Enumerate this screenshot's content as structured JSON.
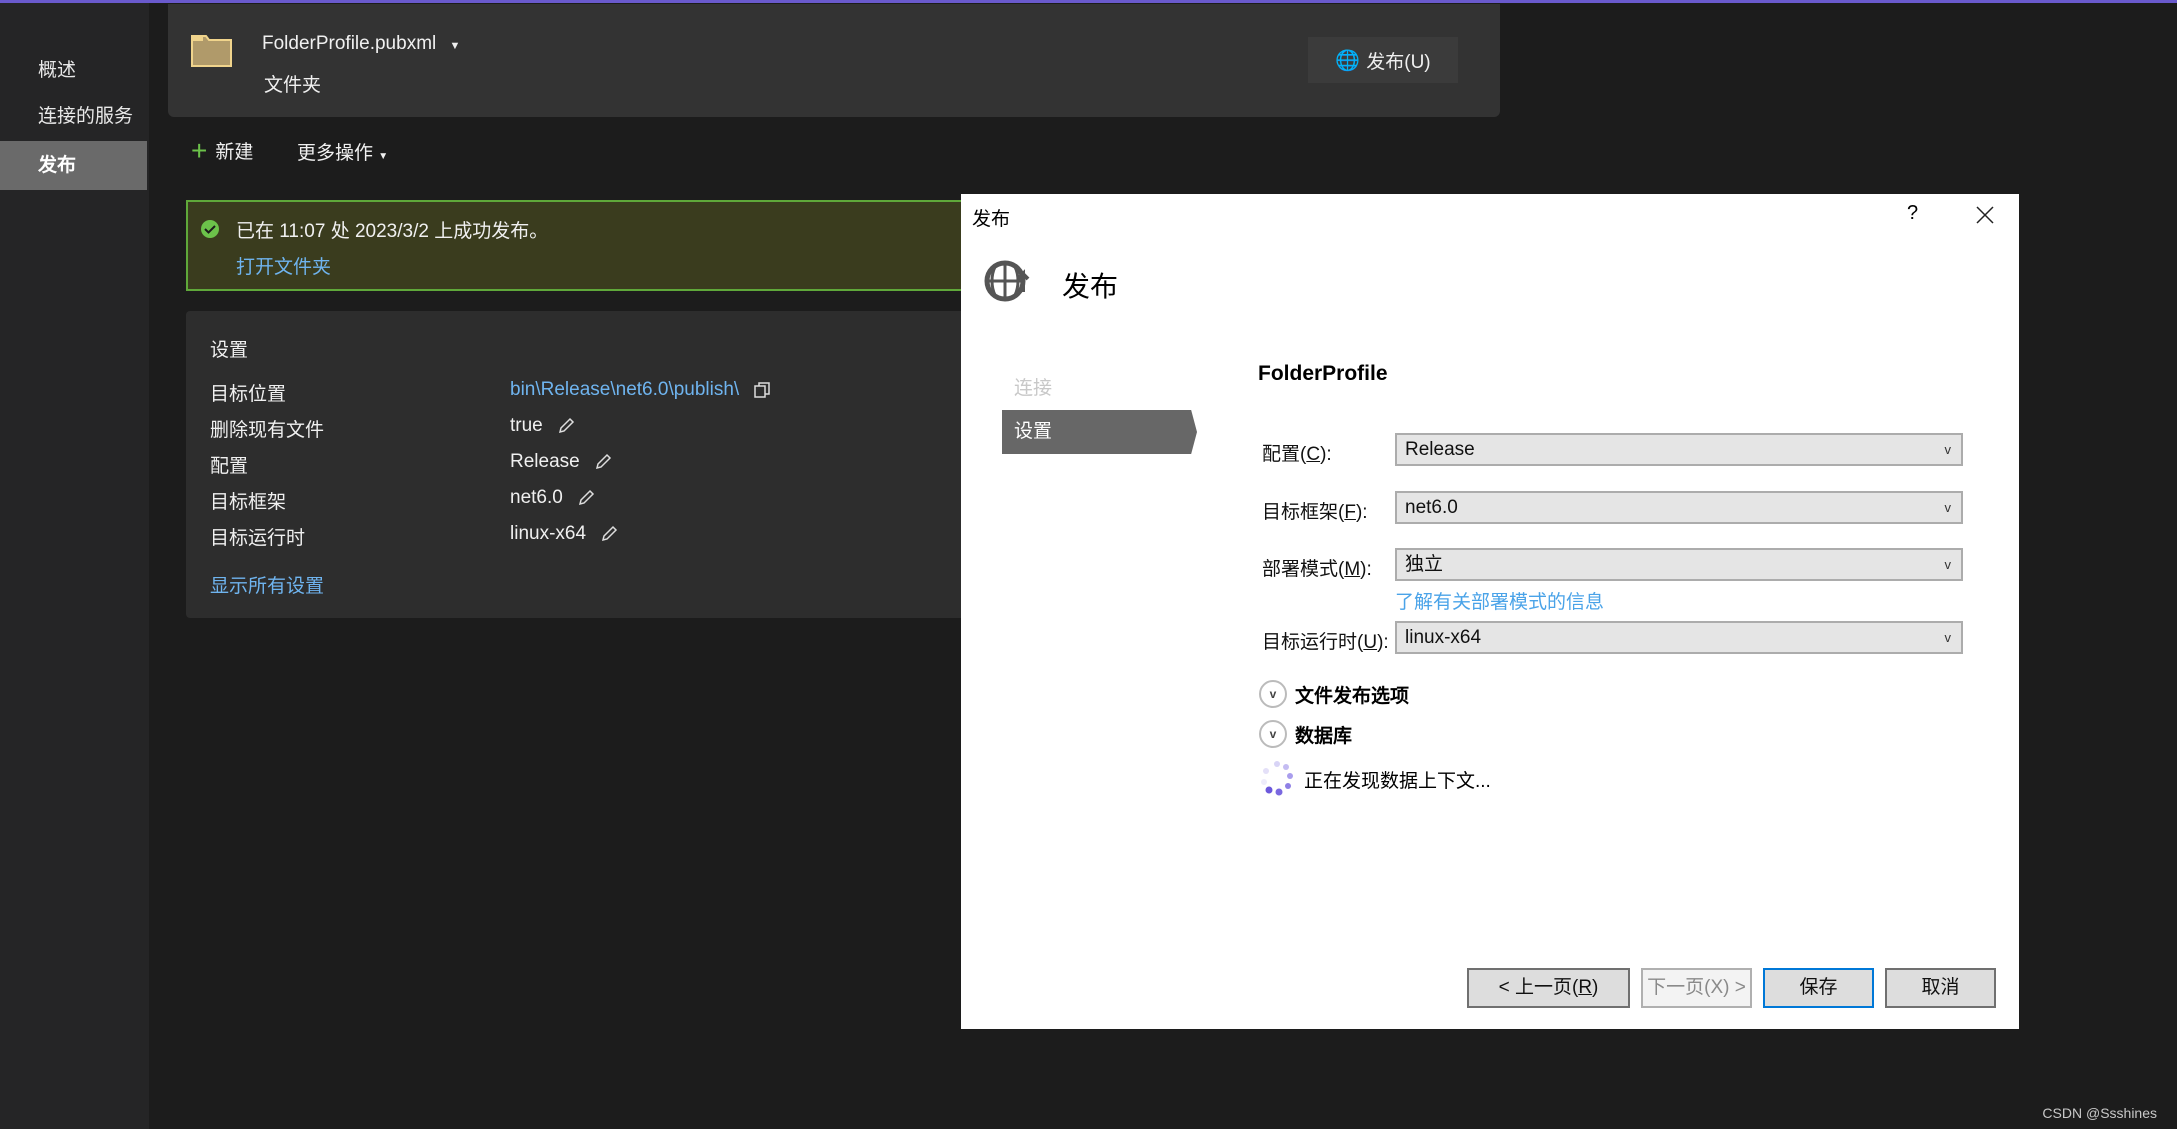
{
  "sidebar": {
    "items": [
      {
        "label": "概述"
      },
      {
        "label": "连接的服务"
      },
      {
        "label": "发布",
        "selected": true
      }
    ]
  },
  "header": {
    "profile_name": "FolderProfile.pubxml",
    "profile_type": "文件夹",
    "publish_button": "发布(U)"
  },
  "toolbar": {
    "new_label": "新建",
    "more_label": "更多操作"
  },
  "banner": {
    "message": "已在 11:07 处 2023/3/2 上成功发布。",
    "link": "打开文件夹"
  },
  "settings": {
    "title": "设置",
    "rows": [
      {
        "label": "目标位置",
        "value": "bin\\Release\\net6.0\\publish\\"
      },
      {
        "label": "删除现有文件",
        "value": "true"
      },
      {
        "label": "配置",
        "value": "Release"
      },
      {
        "label": "目标框架",
        "value": "net6.0"
      },
      {
        "label": "目标运行时",
        "value": "linux-x64"
      }
    ],
    "show_all": "显示所有设置"
  },
  "dialog": {
    "title": "发布",
    "help": "?",
    "heading": "发布",
    "nav": {
      "connect": "连接",
      "settings": "设置"
    },
    "profile": "FolderProfile",
    "fields": {
      "config": {
        "label": "配置(",
        "key": "C",
        "label_end": "):",
        "value": "Release"
      },
      "framework": {
        "label": "目标框架(",
        "key": "F",
        "label_end": "):",
        "value": "net6.0"
      },
      "deploy": {
        "label": "部署模式(",
        "key": "M",
        "label_end": "):",
        "value": "独立"
      },
      "runtime": {
        "label": "目标运行时(",
        "key": "U",
        "label_end": "):",
        "value": "linux-x64"
      }
    },
    "deploy_link": "了解有关部署模式的信息",
    "file_options": "文件发布选项",
    "database": "数据库",
    "discovering": "正在发现数据上下文...",
    "buttons": {
      "prev": "< 上一页(",
      "prev_key": "R",
      "prev_end": ")",
      "next": "下一页(X) >",
      "save": "保存",
      "cancel": "取消"
    }
  },
  "watermark": "CSDN @Ssshines",
  "colors": {
    "accent": "#0078d7",
    "link": "#6fb4ef",
    "success": "#5fa83a"
  }
}
